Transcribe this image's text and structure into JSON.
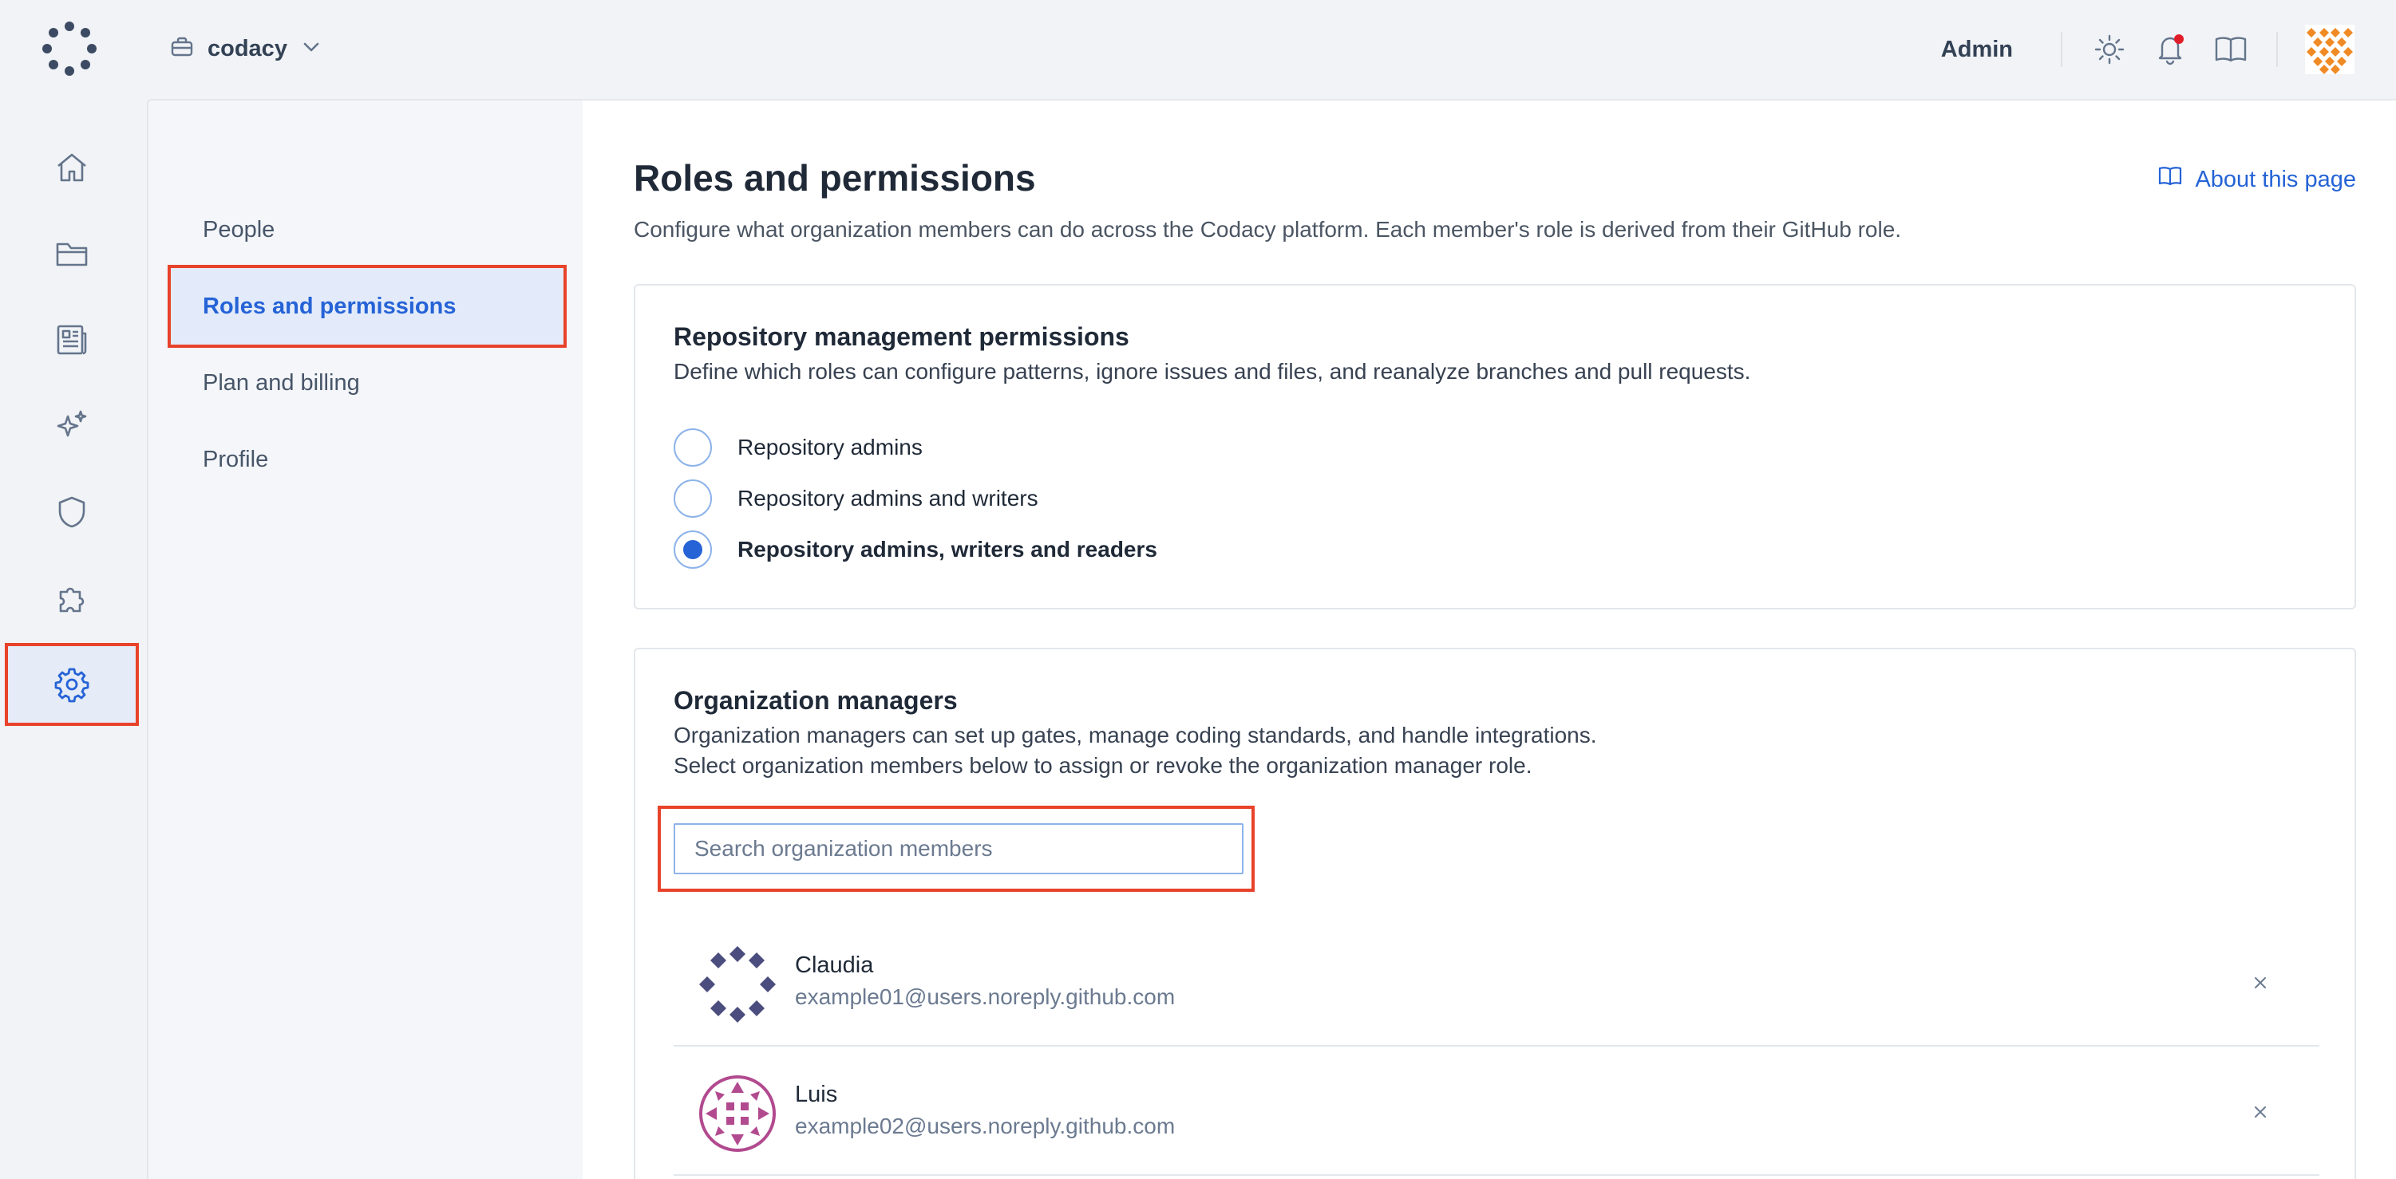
{
  "header": {
    "org_name": "codacy",
    "role_label": "Admin",
    "icons": [
      "codacy-logo-icon",
      "briefcase-icon",
      "chevron-down-icon",
      "sun-icon",
      "bell-icon",
      "book-icon",
      "user-avatar"
    ]
  },
  "rail": {
    "items": [
      "home-icon",
      "folder-icon",
      "newspaper-icon",
      "sparkles-icon",
      "shield-icon",
      "puzzle-icon",
      "gear-icon"
    ],
    "active": "gear-icon"
  },
  "subnav": {
    "items": [
      {
        "label": "People"
      },
      {
        "label": "Roles and permissions"
      },
      {
        "label": "Plan and billing"
      },
      {
        "label": "Profile"
      }
    ],
    "active_index": 1
  },
  "page": {
    "title": "Roles and permissions",
    "description": "Configure what organization members can do across the Codacy platform. Each member's role is derived from their GitHub role.",
    "about_link": "About this page"
  },
  "repo_permissions": {
    "title": "Repository management permissions",
    "description": "Define which roles can configure patterns, ignore issues and files, and reanalyze branches and pull requests.",
    "options": [
      {
        "label": "Repository admins",
        "checked": false
      },
      {
        "label": "Repository admins and writers",
        "checked": false
      },
      {
        "label": "Repository admins, writers and readers",
        "checked": true
      }
    ]
  },
  "org_managers": {
    "title": "Organization managers",
    "description_line1": "Organization managers can set up gates, manage coding standards, and handle integrations.",
    "description_line2": "Select organization members below to assign or revoke the organization manager role.",
    "search_placeholder": "Search organization members",
    "members": [
      {
        "name": "Claudia",
        "email": "example01@users.noreply.github.com",
        "avatar_color": "#4b4d7e"
      },
      {
        "name": "Luis",
        "email": "example02@users.noreply.github.com",
        "avatar_color": "#b24a8f"
      }
    ]
  },
  "colors": {
    "accent": "#2563d6",
    "highlight_outline": "#e8432a",
    "user_avatar": "#f08a24"
  }
}
